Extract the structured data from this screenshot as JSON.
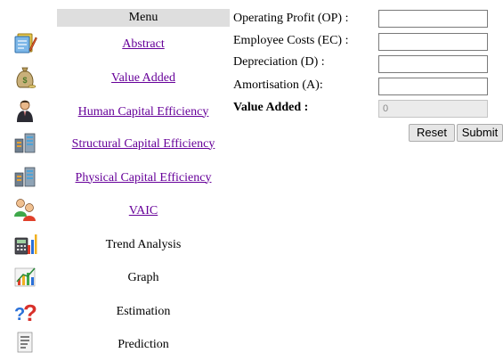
{
  "menu": {
    "header": "Menu",
    "items": [
      {
        "label": "Abstract",
        "icon": "notebook-pencil-icon",
        "link": true
      },
      {
        "label": "Value Added",
        "icon": "money-bag-icon",
        "link": true
      },
      {
        "label": "Human Capital Efficiency",
        "icon": "businessman-icon",
        "link": true
      },
      {
        "label": "Structural Capital Efficiency",
        "icon": "server-stack-icon",
        "link": true
      },
      {
        "label": "Physical Capital Efficiency",
        "icon": "server-stack-icon",
        "link": true
      },
      {
        "label": "VAIC",
        "icon": "people-icon",
        "link": true
      },
      {
        "label": "Trend Analysis",
        "icon": "calculator-chart-icon",
        "link": false
      },
      {
        "label": "Graph",
        "icon": "bar-graph-icon",
        "link": false
      },
      {
        "label": "Estimation",
        "icon": "question-marks-icon",
        "link": false
      },
      {
        "label": "Prediction",
        "icon": "document-icon",
        "link": false
      }
    ]
  },
  "form": {
    "fields": [
      {
        "label": "Operating Profit (OP) :",
        "value": ""
      },
      {
        "label": "Employee Costs (EC) :",
        "value": ""
      },
      {
        "label": "Depreciation (D) :",
        "value": ""
      },
      {
        "label": "Amortisation (A):",
        "value": ""
      }
    ],
    "result_label": "Value Added :",
    "result_value": "0",
    "reset_label": "Reset",
    "submit_label": "Submit"
  },
  "colors": {
    "link": "#660099",
    "menu_header_bg": "#dedede",
    "readonly_bg": "#ebebeb"
  }
}
